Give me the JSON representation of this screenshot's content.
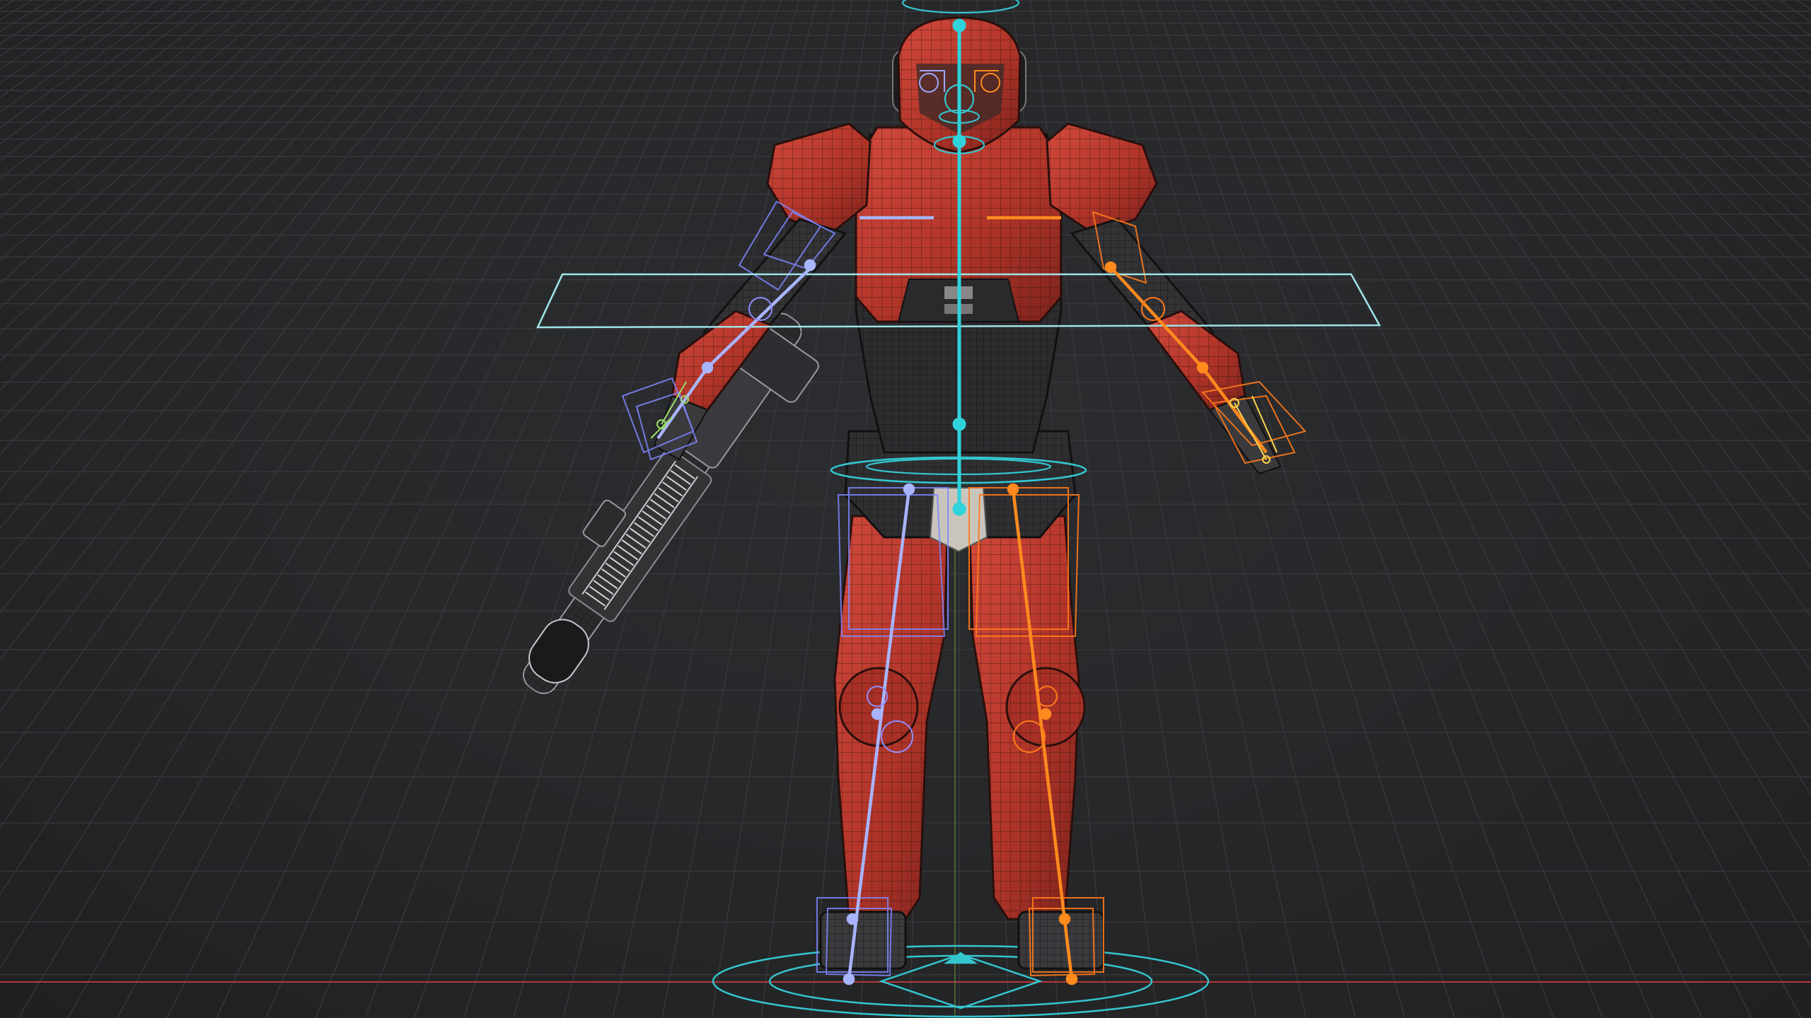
{
  "viewport": {
    "view": "front-orthographic",
    "shading": "wireframe-on-shaded",
    "colors": {
      "background": "#232426",
      "grid": "#3a3b3e",
      "x_axis": "#b3363a",
      "z_axis": "#5f8f3a",
      "armor": "#b83a30",
      "undersuit": "#3a3a3d",
      "control_cyan": "#34c6cf",
      "bone_left": "#9aa8ff",
      "bone_right": "#ff8a1e"
    },
    "objects": [
      {
        "name": "character-mesh",
        "icon": "mesh-icon"
      },
      {
        "name": "armature-rig",
        "icon": "armature-icon"
      },
      {
        "name": "rifle-prop",
        "icon": "mesh-icon"
      }
    ]
  }
}
